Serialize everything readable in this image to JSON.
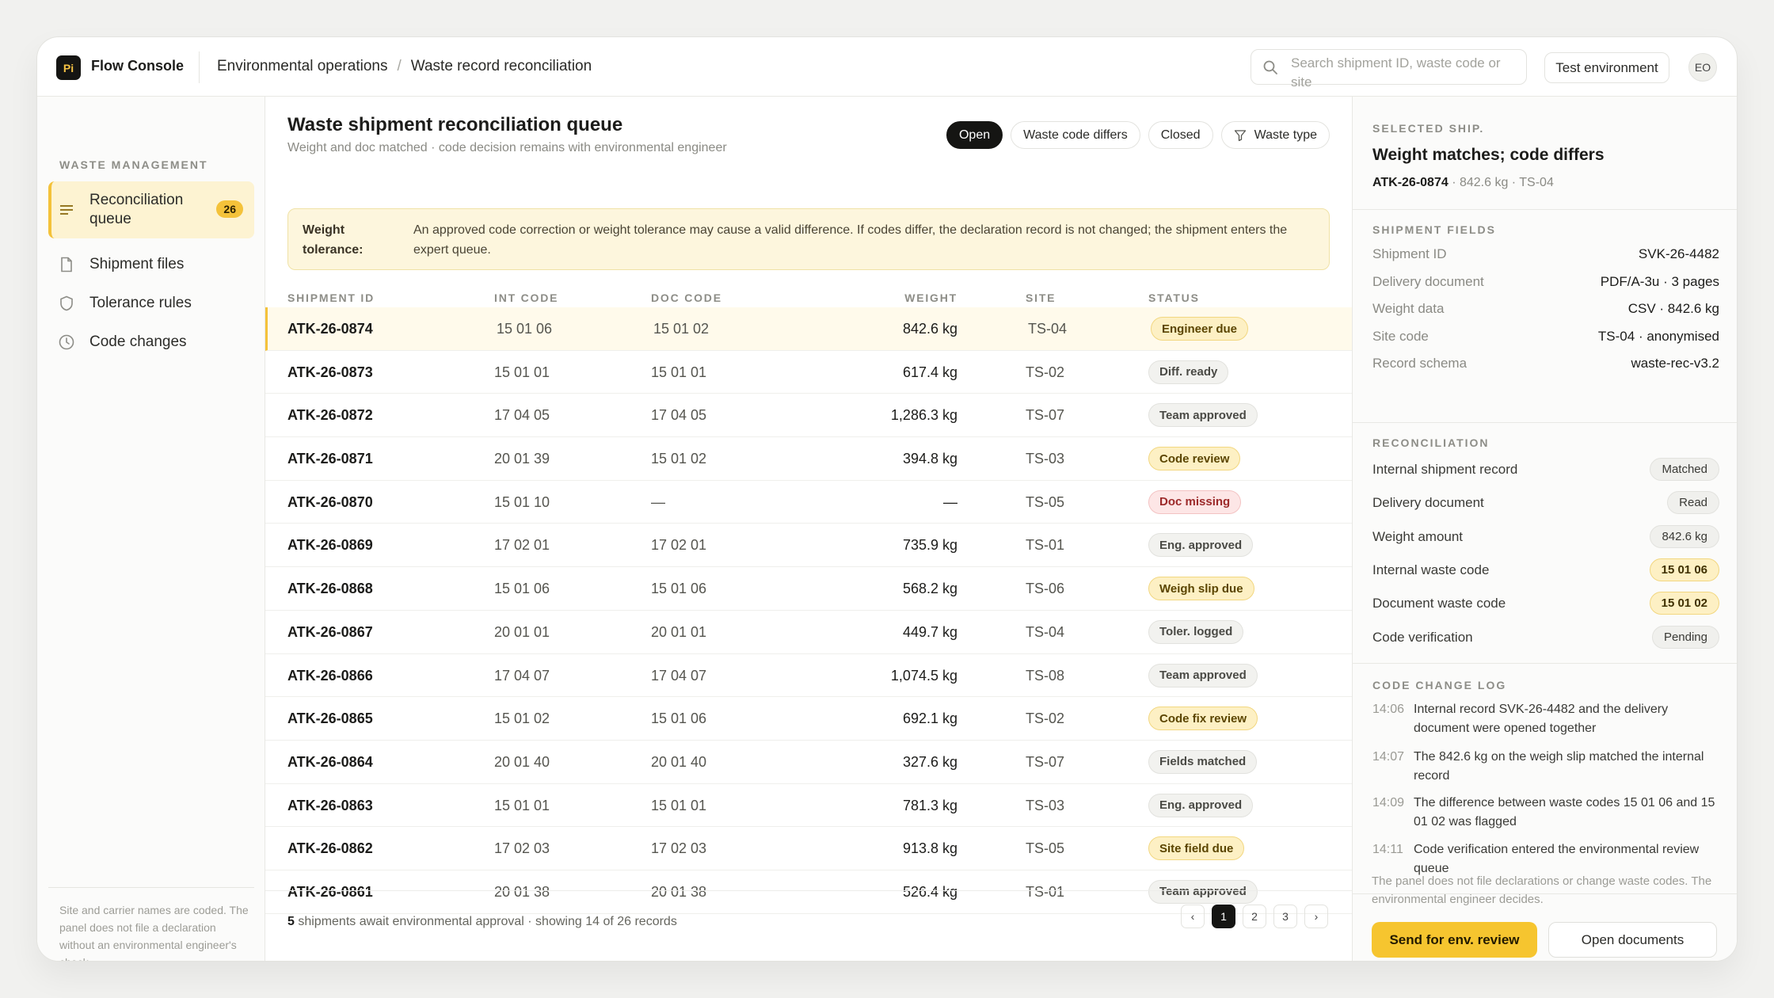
{
  "app": {
    "logo_text": "Pi",
    "name": "Flow Console"
  },
  "breadcrumb": {
    "parent": "Environmental operations",
    "separator": "/",
    "current": "Waste record reconciliation"
  },
  "search": {
    "placeholder": "Search shipment ID, waste code or site"
  },
  "env_button": "Test environment",
  "avatar": "EO",
  "sidebar": {
    "heading": "WASTE MANAGEMENT",
    "items": [
      {
        "label": "Reconciliation queue",
        "icon": "list-icon",
        "badge": "26",
        "active": true
      },
      {
        "label": "Shipment files",
        "icon": "file-icon"
      },
      {
        "label": "Tolerance rules",
        "icon": "shield-icon"
      },
      {
        "label": "Code changes",
        "icon": "clock-icon"
      }
    ],
    "footer": "Site and carrier names are coded. The panel does not file a declaration without an environmental engineer's check."
  },
  "main": {
    "title": "Waste shipment reconciliation queue",
    "subtitle": "Weight and doc matched · code decision remains with environmental engineer",
    "filters": {
      "open": "Open",
      "differs": "Waste code differs",
      "closed": "Closed",
      "type": "Waste type"
    },
    "callout": {
      "key": "Weight tolerance:",
      "text": "An approved code correction or weight tolerance may cause a valid difference. If codes differ, the declaration record is not changed; the shipment enters the expert queue."
    },
    "columns": {
      "id": "SHIPMENT ID",
      "int": "INT CODE",
      "doc": "DOC CODE",
      "weight": "WEIGHT",
      "site": "SITE",
      "status": "STATUS"
    },
    "rows": [
      {
        "id": "ATK-26-0874",
        "int": "15 01 06",
        "doc": "15 01 02",
        "weight": "842.6 kg",
        "site": "TS-04",
        "status": "Engineer due",
        "tone": "yellow",
        "selected": true
      },
      {
        "id": "ATK-26-0873",
        "int": "15 01 01",
        "doc": "15 01 01",
        "weight": "617.4 kg",
        "site": "TS-02",
        "status": "Diff. ready",
        "tone": "gray"
      },
      {
        "id": "ATK-26-0872",
        "int": "17 04 05",
        "doc": "17 04 05",
        "weight": "1,286.3 kg",
        "site": "TS-07",
        "status": "Team approved",
        "tone": "gray"
      },
      {
        "id": "ATK-26-0871",
        "int": "20 01 39",
        "doc": "15 01 02",
        "weight": "394.8 kg",
        "site": "TS-03",
        "status": "Code review",
        "tone": "yellow"
      },
      {
        "id": "ATK-26-0870",
        "int": "15 01 10",
        "doc": "—",
        "weight": "—",
        "site": "TS-05",
        "status": "Doc missing",
        "tone": "red"
      },
      {
        "id": "ATK-26-0869",
        "int": "17 02 01",
        "doc": "17 02 01",
        "weight": "735.9 kg",
        "site": "TS-01",
        "status": "Eng. approved",
        "tone": "gray"
      },
      {
        "id": "ATK-26-0868",
        "int": "15 01 06",
        "doc": "15 01 06",
        "weight": "568.2 kg",
        "site": "TS-06",
        "status": "Weigh slip due",
        "tone": "yellow"
      },
      {
        "id": "ATK-26-0867",
        "int": "20 01 01",
        "doc": "20 01 01",
        "weight": "449.7 kg",
        "site": "TS-04",
        "status": "Toler. logged",
        "tone": "gray"
      },
      {
        "id": "ATK-26-0866",
        "int": "17 04 07",
        "doc": "17 04 07",
        "weight": "1,074.5 kg",
        "site": "TS-08",
        "status": "Team approved",
        "tone": "gray"
      },
      {
        "id": "ATK-26-0865",
        "int": "15 01 02",
        "doc": "15 01 06",
        "weight": "692.1 kg",
        "site": "TS-02",
        "status": "Code fix review",
        "tone": "yellow"
      },
      {
        "id": "ATK-26-0864",
        "int": "20 01 40",
        "doc": "20 01 40",
        "weight": "327.6 kg",
        "site": "TS-07",
        "status": "Fields matched",
        "tone": "gray"
      },
      {
        "id": "ATK-26-0863",
        "int": "15 01 01",
        "doc": "15 01 01",
        "weight": "781.3 kg",
        "site": "TS-03",
        "status": "Eng. approved",
        "tone": "gray"
      },
      {
        "id": "ATK-26-0862",
        "int": "17 02 03",
        "doc": "17 02 03",
        "weight": "913.8 kg",
        "site": "TS-05",
        "status": "Site field due",
        "tone": "yellow"
      },
      {
        "id": "ATK-26-0861",
        "int": "20 01 38",
        "doc": "20 01 38",
        "weight": "526.4 kg",
        "site": "TS-01",
        "status": "Team approved",
        "tone": "gray"
      }
    ],
    "footer": {
      "count": "5",
      "text": " shipments await environmental approval · showing 14 of 26 records"
    },
    "pager": {
      "prev": "‹",
      "pages": [
        "1",
        "2",
        "3"
      ],
      "next": "›"
    }
  },
  "panel": {
    "heading": "SELECTED SHIP.",
    "title": "Weight matches; code differs",
    "sub_id": "ATK-26-0874",
    "sub_rest": " · 842.6 kg · TS-04",
    "fields_heading": "SHIPMENT FIELDS",
    "fields": [
      {
        "k": "Shipment ID",
        "v": "SVK-26-4482"
      },
      {
        "k": "Delivery document",
        "v": "PDF/A-3u · 3 pages"
      },
      {
        "k": "Weight data",
        "v": "CSV · 842.6 kg"
      },
      {
        "k": "Site code",
        "v": "TS-04 · anonymised"
      },
      {
        "k": "Record schema",
        "v": "waste-rec-v3.2"
      }
    ],
    "recon_heading": "RECONCILIATION",
    "recon": [
      {
        "k": "Internal shipment record",
        "v": "Matched",
        "tone": "gray"
      },
      {
        "k": "Delivery document",
        "v": "Read",
        "tone": "gray"
      },
      {
        "k": "Weight amount",
        "v": "842.6 kg",
        "tone": "gray"
      },
      {
        "k": "Internal waste code",
        "v": "15 01 06",
        "tone": "yel"
      },
      {
        "k": "Document waste code",
        "v": "15 01 02",
        "tone": "yel"
      },
      {
        "k": "Code verification",
        "v": "Pending",
        "tone": "gray"
      }
    ],
    "log_heading": "CODE CHANGE LOG",
    "log": [
      {
        "t": "14:06",
        "d": "Internal record SVK-26-4482 and the delivery document were opened together"
      },
      {
        "t": "14:07",
        "d": "The 842.6 kg on the weigh slip matched the internal record"
      },
      {
        "t": "14:09",
        "d": "The difference between waste codes 15 01 06 and 15 01 02 was flagged"
      },
      {
        "t": "14:11",
        "d": "Code verification entered the environmental review queue"
      }
    ],
    "note": "The panel does not file declarations or change waste codes. The environmental engineer decides.",
    "primary_button": "Send for env. review",
    "secondary_button": "Open documents"
  }
}
